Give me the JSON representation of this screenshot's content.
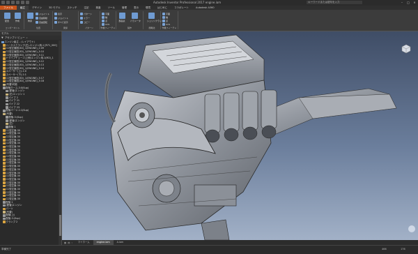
{
  "titlebar": {
    "title": "Autodesk Inventor Professional 2017  engine.iam",
    "search_placeholder": "キーワードまたは語句を入力",
    "window_buttons": [
      "–",
      "□",
      "×"
    ]
  },
  "ribbon_tabs": [
    "ファイル",
    "組立",
    "デザイン",
    "3D モデル",
    "スケッチ",
    "注記",
    "検査",
    "ツール",
    "管理",
    "表示",
    "環境",
    "はじめに",
    "コラボレート",
    "Autodesk A360"
  ],
  "ribbon": {
    "groups": [
      {
        "label": "コンポーネント",
        "buttons": [
          "配置",
          "作成"
        ]
      },
      {
        "label": "位置",
        "buttons": [
          "拘束",
          "ジョイント",
          "自由移動",
          "自由回転"
        ]
      },
      {
        "label": "関係",
        "buttons": [
          "表示",
          "ジョイント",
          "すべて表示"
        ]
      },
      {
        "label": "パターン",
        "buttons": [
          "パターン",
          "ミラー",
          "コピー"
        ]
      },
      {
        "label": "作業フィーチャ",
        "buttons": [
          "平面",
          "軸",
          "点",
          "UCS"
        ]
      },
      {
        "label": "製作",
        "buttons": [
          "部品表",
          "パラメータ"
        ]
      },
      {
        "label": "簡略化",
        "buttons": [
          "シュリンクラップ"
        ]
      },
      {
        "label": "作業フィーチャ",
        "buttons": [
          "平面",
          "軸",
          "点",
          "UCS"
        ]
      }
    ]
  },
  "browser": {
    "title": "モデル",
    "view_label": "アセンブリ ビュー",
    "items": [
      "エンジン組立 - (レイアウト)",
      "ハーネスクランプ(左)-エンジン用-1 [R71_000]",
      "CC型正面図(3D)_1(ENGINE)_2:09",
      "CC型正面図(3D)_1(ENGINE)_3:10",
      "CC型正面図(3D)_1(ENGINE)_3:11",
      "ドライブチェーン(上側)エンジン用-1(M2)_1",
      "CC型正面図(3D)_1(ENGINE)_3:12",
      "CC型正面図(3D)_1(ENGINE)_3:13",
      "CC型正面図(3D)_1(ENGINE)_3:14",
      "スペーサー(上)-1:0",
      "スペーサー(下)-1:1",
      "CC型正面図(3D)_1(ENGINE)_3:17",
      "CC型正面図(3D)_1(ENGINE)_3:18",
      "(代替)可能",
      "配管ホース-3:0(Sup)",
      "(配管)エンジン",
      "(左)エンジン 1",
      "パイプ 2",
      "パイプ 21",
      "パイプ 22",
      "パイプ 23",
      "配管パーツ-1:1(Sup)",
      "(代替)",
      "配管-3:(Sup)",
      "(配管)エンジン",
      "(左)",
      "配管 1",
      "CC型正面-30",
      "CC型正面-30",
      "CC型正面-30",
      "CC型正面-30",
      "CC型正面-30",
      "CC型正面-30",
      "CC型正面-30",
      "CC型正面-30",
      "CC型正面-30",
      "CC型正面-30",
      "CC型正面-30",
      "CC型正面-30",
      "CC型正面-30",
      "CC型正面-30",
      "CC型正面-30",
      "CC型正面-30",
      "CC型正面-30",
      "CC型正面-30",
      "CC型正面-30",
      "CC型正面-30",
      "CC型正面-30",
      "CC型正面-30",
      "配管 2",
      "(配管)エンジン",
      "パーツ",
      "(代替)",
      "配管(上)",
      "配管-3:(Sup)",
      "クランプ 2"
    ]
  },
  "document_tabs": [
    "マイホーム",
    "engine.iam",
    "A.iam"
  ],
  "status": {
    "ready": "準備完了",
    "count1": "466",
    "count2": "176"
  },
  "colors": {
    "file_tab": "#c8541b",
    "viewport_top": "#3f4d66",
    "viewport_bottom": "#a2b1c7",
    "part_icon": "#d9a441"
  }
}
